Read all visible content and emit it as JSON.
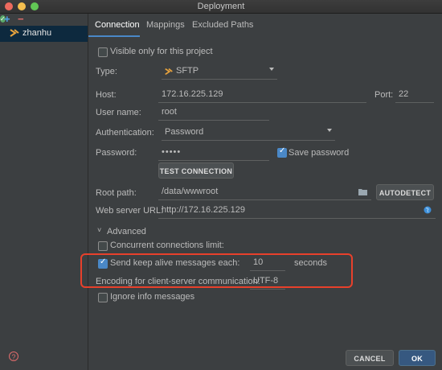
{
  "window": {
    "title": "Deployment"
  },
  "sidebar": {
    "server": "zhanhu"
  },
  "tabs": [
    {
      "label": "Connection"
    },
    {
      "label": "Mappings"
    },
    {
      "label": "Excluded Paths"
    }
  ],
  "connection": {
    "visible_only_label": "Visible only for this project",
    "type_label": "Type:",
    "type_value": "SFTP",
    "host_label": "Host:",
    "host_value": "172.16.225.129",
    "port_label": "Port:",
    "port_value": "22",
    "username_label": "User name:",
    "username_value": "root",
    "auth_label": "Authentication:",
    "auth_value": "Password",
    "password_label": "Password:",
    "password_value": "•••••",
    "save_password_label": "Save password",
    "test_connection_label": "TEST CONNECTION",
    "root_path_label": "Root path:",
    "root_path_value": "/data/wwwroot",
    "autodetect_label": "AUTODETECT",
    "web_url_label": "Web server URL:",
    "web_url_value": "http://172.16.225.129"
  },
  "advanced": {
    "header": "Advanced",
    "concurrent_label": "Concurrent connections limit:",
    "keep_alive_label": "Send keep alive messages each:",
    "keep_alive_value": "10",
    "keep_alive_unit": "seconds",
    "encoding_label": "Encoding for client-server communication:",
    "encoding_value": "UTF-8",
    "ignore_info_label": "Ignore info messages"
  },
  "footer": {
    "cancel_label": "CANCEL",
    "ok_label": "OK"
  },
  "colors": {
    "accent": "#4a88c7",
    "highlight": "#e8402b",
    "background": "#3c3f41"
  }
}
